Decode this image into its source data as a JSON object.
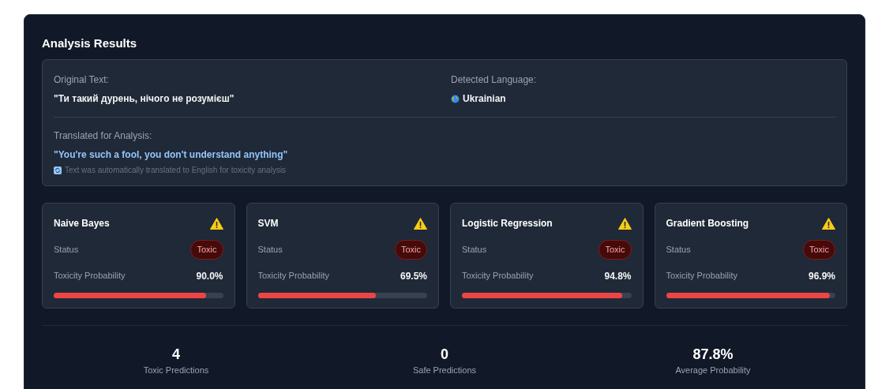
{
  "title": "Analysis Results",
  "original": {
    "label": "Original Text:",
    "text": "\"Ти такий дурень, нічого не розумієш\""
  },
  "language": {
    "label": "Detected Language:",
    "value": "Ukrainian"
  },
  "translation": {
    "label": "Translated for Analysis:",
    "text": "\"You're such a fool, you don't understand anything\"",
    "note": "Text was automatically translated to English for toxicity analysis"
  },
  "models": [
    {
      "name": "Naive Bayes",
      "status_label": "Status",
      "status": "Toxic",
      "kind": "toxic",
      "prob_label": "Toxicity Probability",
      "reading": "90.0%",
      "level": 0.9
    },
    {
      "name": "SVM",
      "status_label": "Status",
      "status": "Toxic",
      "kind": "toxic",
      "prob_label": "Toxicity Probability",
      "reading": "69.5%",
      "level": 0.695
    },
    {
      "name": "Logistic Regression",
      "status_label": "Status",
      "status": "Toxic",
      "kind": "toxic",
      "prob_label": "Toxicity Probability",
      "reading": "94.8%",
      "level": 0.948
    },
    {
      "name": "Gradient Boosting",
      "status_label": "Status",
      "status": "Toxic",
      "kind": "toxic",
      "prob_label": "Toxicity Probability",
      "reading": "96.9%",
      "level": 0.969
    }
  ],
  "summary": [
    {
      "value": "4",
      "label": "Toxic Predictions"
    },
    {
      "value": "0",
      "label": "Safe Predictions"
    },
    {
      "value": "87.8%",
      "label": "Average Probability"
    }
  ]
}
